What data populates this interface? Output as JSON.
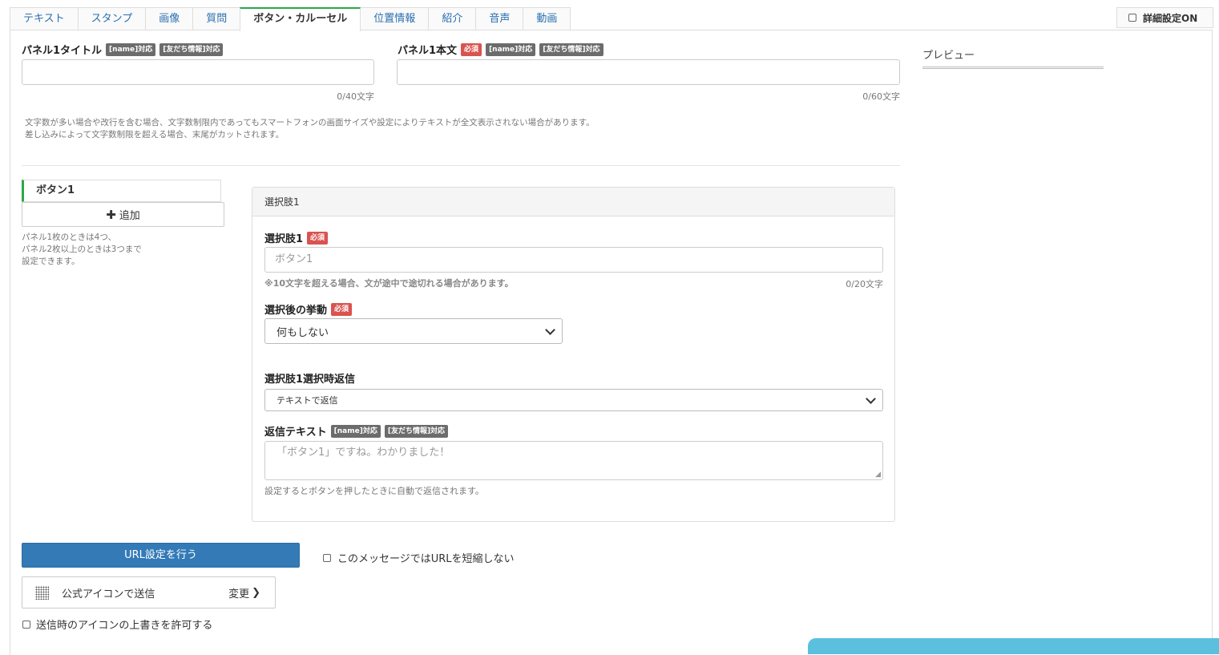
{
  "tabs": [
    {
      "label": "テキスト",
      "active": false
    },
    {
      "label": "スタンプ",
      "active": false
    },
    {
      "label": "画像",
      "active": false
    },
    {
      "label": "質問",
      "active": false
    },
    {
      "label": "ボタン・カルーセル",
      "active": true
    },
    {
      "label": "位置情報",
      "active": false
    },
    {
      "label": "紹介",
      "active": false
    },
    {
      "label": "音声",
      "active": false
    },
    {
      "label": "動画",
      "active": false
    }
  ],
  "advanced_toggle": {
    "label": "詳細設定ON",
    "checked": false
  },
  "panel": {
    "title_label": "パネル1タイトル",
    "title_badges": [
      "[name]対応",
      "[友だち情報]対応"
    ],
    "title_value": "",
    "title_counter": "0/40文字",
    "body_label": "パネル1本文",
    "body_required": "必須",
    "body_badges": [
      "[name]対応",
      "[友だち情報]対応"
    ],
    "body_value": "",
    "body_counter": "0/60文字",
    "note_line1": "文字数が多い場合や改行を含む場合、文字数制限内であってもスマートフォンの画面サイズや設定によりテキストが全文表示されない場合があります。",
    "note_line2": "差し込みによって文字数制限を超える場合、末尾がカットされます。"
  },
  "preview": {
    "label": "プレビュー"
  },
  "buttons_sidebar": {
    "active_item": "ボタン1",
    "add_label": "追加",
    "note_line1": "パネル1枚のときは4つ、",
    "note_line2": "パネル2枚以上のときは3つまで",
    "note_line3": "設定できます。"
  },
  "choice_card": {
    "header": "選択肢1",
    "choice_label": "選択肢1",
    "required": "必須",
    "choice_placeholder": "ボタン1",
    "choice_note": "※10文字を超える場合、文が途中で途切れる場合があります。",
    "choice_counter": "0/20文字",
    "action_label": "選択後の挙動",
    "action_value": "何もしない",
    "reply_mode_label": "選択肢1選択時返信",
    "reply_mode_value": "テキストで返信",
    "reply_text_label": "返信テキスト",
    "reply_badges": [
      "[name]対応",
      "[友だち情報]対応"
    ],
    "reply_placeholder": "「ボタン1」ですね。わかりました！",
    "reply_note": "設定するとボタンを押したときに自動で返信されます。"
  },
  "footer": {
    "url_button": "URL設定を行う",
    "no_shorten_label": "このメッセージではURLを短縮しない",
    "icon_send_label": "公式アイコンで送信",
    "change_label": "変更",
    "override_label": "送信時のアイコンの上書きを許可する"
  },
  "colors": {
    "accent_green": "#2aa84a",
    "primary_blue": "#337ab7",
    "required_red": "#d9534f",
    "badge_gray": "#6c6c6c",
    "link_blue": "#2a6fb0"
  }
}
